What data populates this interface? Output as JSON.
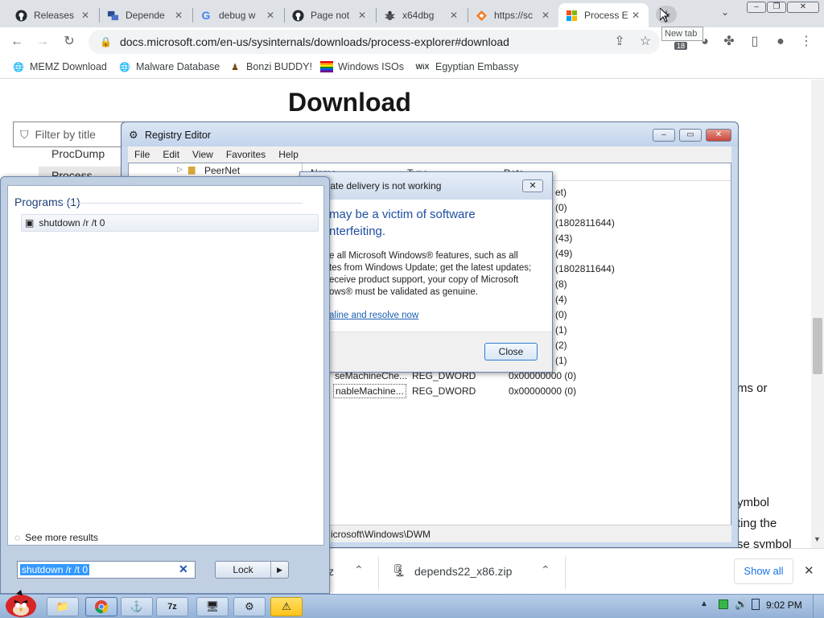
{
  "browser": {
    "tabs": [
      {
        "title": "Releases",
        "icon": "github-icon"
      },
      {
        "title": "Depende",
        "icon": "app-icon"
      },
      {
        "title": "debug w",
        "icon": "google-icon"
      },
      {
        "title": "Page not",
        "icon": "github-icon"
      },
      {
        "title": "x64dbg",
        "icon": "bug-icon"
      },
      {
        "title": "https://sc",
        "icon": "diamond-icon"
      },
      {
        "title": "Process E",
        "icon": "microsoft-icon",
        "active": true
      }
    ],
    "new_tab_tooltip": "New tab",
    "url": "docs.microsoft.com/en-us/sysinternals/downloads/process-explorer#download",
    "extension_badge": "18",
    "bookmarks": [
      {
        "label": "MEMZ Download",
        "icon": "globe-icon"
      },
      {
        "label": "Malware Database",
        "icon": "globe-icon"
      },
      {
        "label": "Bonzi BUDDY!",
        "icon": "bonzi-icon"
      },
      {
        "label": "Windows ISOs",
        "icon": "rainbow-icon"
      },
      {
        "label": "Egyptian Embassy",
        "icon": "wix-icon",
        "icon_text": "WiX"
      }
    ]
  },
  "page": {
    "heading": "Download",
    "filter_placeholder": "Filter by title",
    "nav_items": [
      "ProcDump",
      "Process Expl"
    ],
    "body_fragments": [
      "ms or",
      "ymbol",
      "ting the",
      "se symbol"
    ]
  },
  "downloads": {
    "items": [
      {
        "name": "z"
      },
      {
        "name": "depends22_x86.zip"
      }
    ],
    "show_all": "Show all"
  },
  "regedit": {
    "title": "Registry Editor",
    "menu": [
      "File",
      "Edit",
      "View",
      "Favorites",
      "Help"
    ],
    "tree_item": "PeerNet",
    "columns": [
      "Name",
      "Type",
      "Data"
    ],
    "data_values": [
      "et)",
      "(0)",
      "(1802811644)",
      "(43)",
      "(49)",
      "(1802811644)",
      "(8)",
      "(4)",
      "(0)",
      "(1)",
      "(2)",
      "(1)"
    ],
    "rows": [
      {
        "name": "seMachineChe...",
        "type": "REG_DWORD",
        "data": "0x00000000 (0)"
      },
      {
        "name": "nableMachine...",
        "type": "REG_DWORD",
        "data": "0x00000000 (0)"
      }
    ],
    "status": "icrosoft\\Windows\\DWM"
  },
  "genuine_dialog": {
    "title": "pdate delivery is not working",
    "headline_1": "may be a victim of software",
    "headline_2": "nterfeiting.",
    "body_lines": [
      "e all Microsoft Windows® features, such as all",
      "tes from Windows Update; get the latest updates;",
      "eceive product support, your copy of Microsoft",
      "ows® must be validated as genuine."
    ],
    "link": "aline and resolve now",
    "close_button": "Close"
  },
  "start_menu": {
    "section_header": "Programs (1)",
    "result": "shutdown /r /t 0",
    "see_more": "See more results",
    "search_value": "shutdown /r /t 0",
    "lock_button": "Lock"
  },
  "taskbar": {
    "clock": "9:02 PM",
    "warning_color": "#ffd21f"
  }
}
